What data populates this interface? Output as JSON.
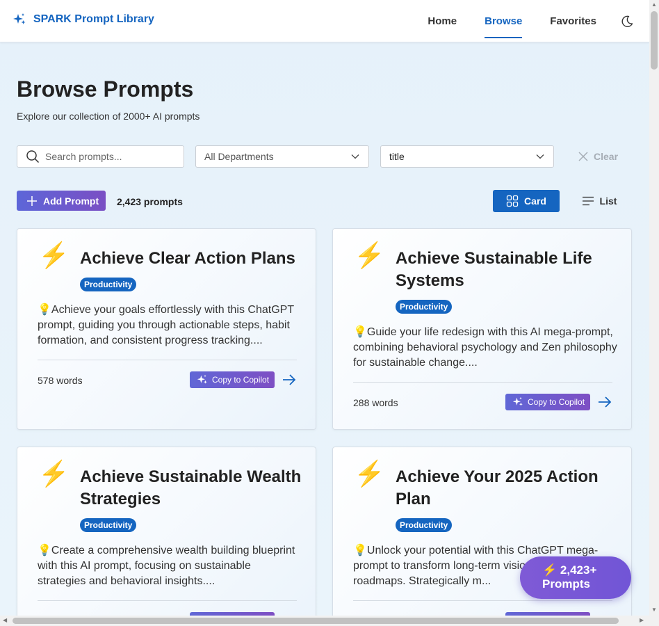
{
  "header": {
    "brand": "SPARK Prompt Library",
    "nav": [
      "Home",
      "Browse",
      "Favorites"
    ],
    "active_nav": "Browse"
  },
  "page": {
    "title": "Browse Prompts",
    "subtitle": "Explore our collection of 2000+ AI prompts"
  },
  "filters": {
    "search_placeholder": "Search prompts...",
    "department": "All Departments",
    "sort": "title",
    "clear_label": "Clear"
  },
  "toolbar": {
    "add_label": "Add Prompt",
    "count": "2,423 prompts",
    "card_label": "Card",
    "list_label": "List"
  },
  "cards": [
    {
      "icon": "⚡",
      "title": "Achieve Clear Action Plans",
      "badge": "Productivity",
      "description": "💡Achieve your goals effortlessly with this ChatGPT prompt, guiding you through actionable steps, habit formation, and consistent progress tracking....",
      "words": "578 words",
      "copy_label": "Copy to Copilot"
    },
    {
      "icon": "⚡",
      "title": "Achieve Sustainable Life Systems",
      "badge": "Productivity",
      "description": "💡Guide your life redesign with this AI mega-prompt, combining behavioral psychology and Zen philosophy for sustainable change....",
      "words": "288 words",
      "copy_label": "Copy to Copilot"
    },
    {
      "icon": "⚡",
      "title": "Achieve Sustainable Wealth Strategies",
      "badge": "Productivity",
      "description": "💡Create a comprehensive wealth building blueprint with this AI prompt, focusing on sustainable strategies and behavioral insights....",
      "words": "",
      "copy_label": ""
    },
    {
      "icon": "⚡",
      "title": "Achieve Your 2025 Action Plan",
      "badge": "Productivity",
      "description": "💡Unlock your potential with this ChatGPT mega-prompt to transform long-term vision into quarterly roadmaps. Strategically m...",
      "words": "",
      "copy_label": ""
    }
  ],
  "fab": {
    "icon": "⚡",
    "label": "2,423+ Prompts"
  },
  "colors": {
    "accent": "#1565c0",
    "gradient_start": "#5d66d8",
    "gradient_end": "#7a4fc4"
  }
}
